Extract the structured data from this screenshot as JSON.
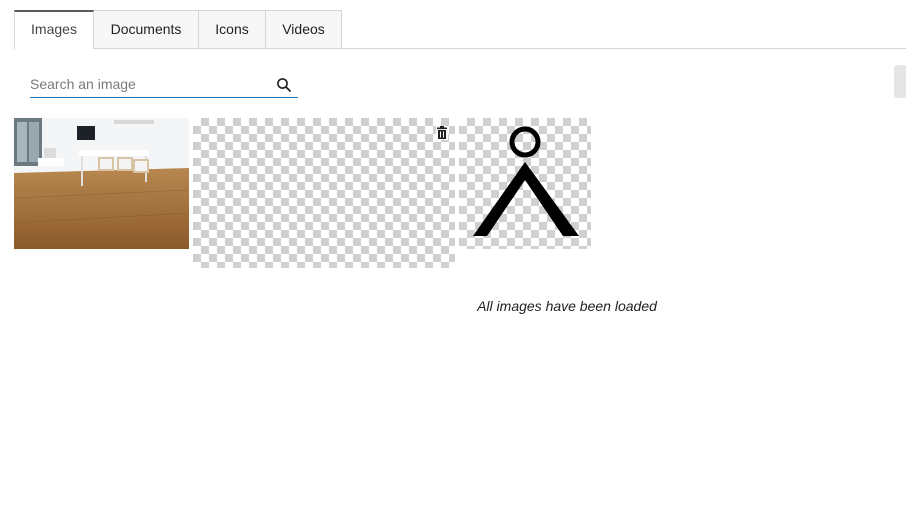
{
  "tabs": [
    {
      "label": "Images",
      "active": true
    },
    {
      "label": "Documents",
      "active": false
    },
    {
      "label": "Icons",
      "active": false
    },
    {
      "label": "Videos",
      "active": false
    }
  ],
  "search": {
    "placeholder": "Search an image",
    "value": "",
    "icon": "search-icon"
  },
  "gallery": {
    "items": [
      {
        "kind": "photo",
        "subject": "room-with-wooden-floor"
      },
      {
        "kind": "transparent",
        "delete_icon": "trash-icon"
      },
      {
        "kind": "icon",
        "subject": "person-symbol"
      }
    ],
    "status_text": "All images have been loaded"
  },
  "colors": {
    "accent": "#1a73b8",
    "active_tab_border": "#5a5a5a"
  }
}
